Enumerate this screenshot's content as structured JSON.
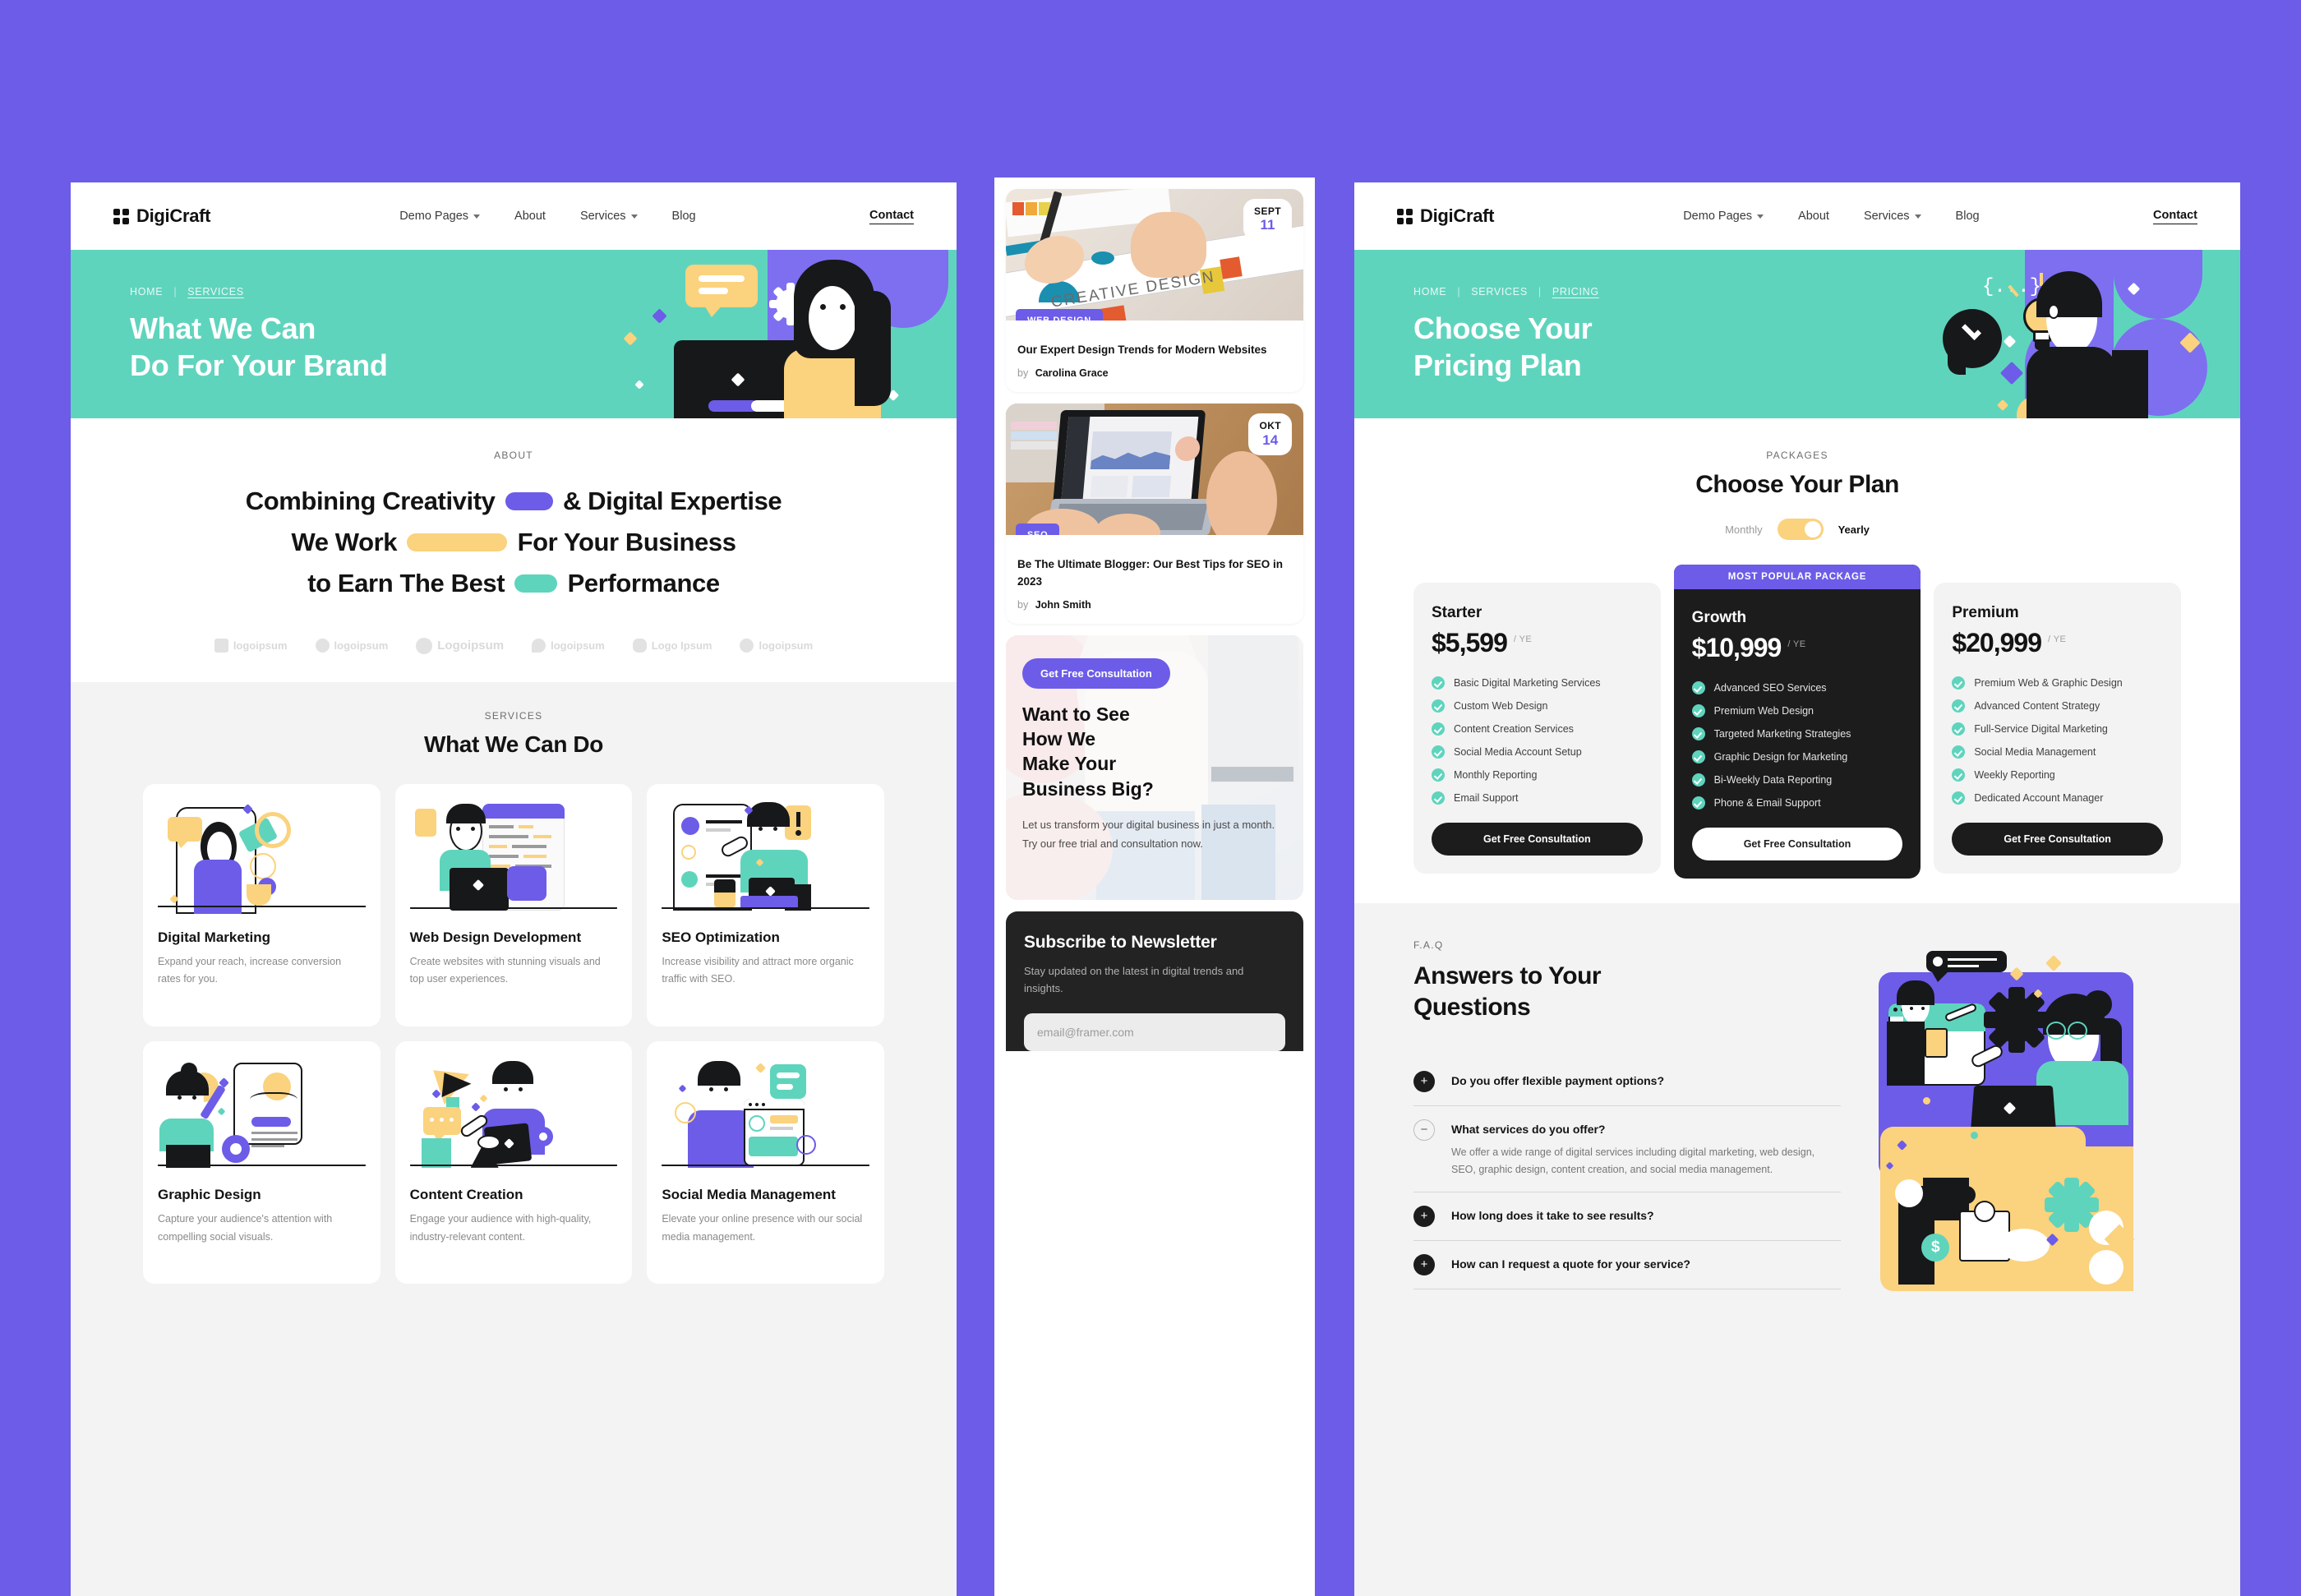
{
  "theme": {
    "bg_purple": "#6c5ce8",
    "teal": "#5fd4bd",
    "amber": "#fbd27d",
    "dark": "#1c1c1d"
  },
  "brand": {
    "name": "DigiCraft"
  },
  "nav": {
    "links": [
      {
        "label": "Demo Pages",
        "caret": true
      },
      {
        "label": "About",
        "caret": false
      },
      {
        "label": "Services",
        "caret": true
      },
      {
        "label": "Blog",
        "caret": false
      }
    ],
    "cta": "Contact"
  },
  "services_page": {
    "breadcrumbs": {
      "home": "HOME",
      "current": "SERVICES"
    },
    "hero_title_line1": "What We Can",
    "hero_title_line2": "Do For Your Brand",
    "about": {
      "eyebrow": "ABOUT",
      "line1_a": "Combining Creativity",
      "line1_b": "& Digital Expertise",
      "line2_a": "We Work",
      "line2_b": "For Your Business",
      "line3_a": "to Earn The Best",
      "line3_b": "Performance"
    },
    "logos": [
      "logoipsum",
      "logoipsum",
      "Logoipsum",
      "logoipsum",
      "Logo Ipsum",
      "logoipsum"
    ],
    "services": {
      "eyebrow": "SERVICES",
      "title": "What We Can Do",
      "cards": [
        {
          "title": "Digital Marketing",
          "desc": "Expand your reach, increase conversion rates for you."
        },
        {
          "title": "Web Design Development",
          "desc": "Create websites with stunning visuals and top user experiences."
        },
        {
          "title": "SEO Optimization",
          "desc": "Increase visibility and attract more organic traffic with SEO."
        },
        {
          "title": "Graphic Design",
          "desc": "Capture your audience's attention with compelling social visuals."
        },
        {
          "title": "Content Creation",
          "desc": "Engage your audience with high-quality, industry-relevant content."
        },
        {
          "title": "Social Media Management",
          "desc": "Elevate your online presence with our social media management."
        }
      ]
    }
  },
  "mobile_page": {
    "posts": [
      {
        "month": "SEPT",
        "day": "11",
        "tag": "WEB DESIGN",
        "title": "Our Expert Design Trends for Modern Websites",
        "by_label": "by",
        "author": "Carolina Grace"
      },
      {
        "month": "OKT",
        "day": "14",
        "tag": "SEO",
        "title": "Be The Ultimate Blogger: Our Best Tips for SEO in 2023",
        "by_label": "by",
        "author": "John Smith"
      }
    ],
    "cta": {
      "button": "Get Free Consultation",
      "title_line1": "Want to See",
      "title_line2": "How We",
      "title_line3": "Make Your",
      "title_line4": "Business Big?",
      "body": "Let us transform your digital business in just a month. Try our free trial and consultation now."
    },
    "newsletter": {
      "title": "Subscribe to Newsletter",
      "subtitle": "Stay updated on the latest in digital trends and insights.",
      "placeholder": "email@framer.com",
      "value": ""
    }
  },
  "pricing_page": {
    "breadcrumbs": {
      "home": "HOME",
      "services": "SERVICES",
      "current": "PRICING"
    },
    "hero_title_line1": "Choose Your",
    "hero_title_line2": "Pricing Plan",
    "packages": {
      "eyebrow": "PACKAGES",
      "title": "Choose Your Plan",
      "toggle": {
        "left": "Monthly",
        "right": "Yearly",
        "selected": "Yearly"
      }
    },
    "plans": [
      {
        "ribbon": "",
        "name": "Starter",
        "price": "$5,599",
        "period": "/ YE",
        "features": [
          "Basic Digital Marketing Services",
          "Custom Web Design",
          "Content Creation Services",
          "Social Media Account Setup",
          "Monthly Reporting",
          "Email Support"
        ],
        "button": "Get Free Consultation"
      },
      {
        "ribbon": "MOST POPULAR PACKAGE",
        "name": "Growth",
        "price": "$10,999",
        "period": "/ YE",
        "features": [
          "Advanced SEO Services",
          "Premium Web Design",
          "Targeted Marketing Strategies",
          "Graphic Design for Marketing",
          "Bi-Weekly Data Reporting",
          "Phone & Email Support"
        ],
        "button": "Get Free Consultation"
      },
      {
        "ribbon": "",
        "name": "Premium",
        "price": "$20,999",
        "period": "/ YE",
        "features": [
          "Premium Web & Graphic Design",
          "Advanced Content Strategy",
          "Full-Service Digital Marketing",
          "Social Media Management",
          "Weekly Reporting",
          "Dedicated Account Manager"
        ],
        "button": "Get Free Consultation"
      }
    ],
    "faq": {
      "eyebrow": "F.A.Q",
      "title_line1": "Answers to Your",
      "title_line2": "Questions",
      "items": [
        {
          "icon": "plus",
          "q": "Do you offer flexible payment options?",
          "a": ""
        },
        {
          "icon": "minus",
          "q": "What services do you offer?",
          "a": "We offer a wide range of digital services including digital marketing, web design, SEO, graphic design, content creation, and social media management."
        },
        {
          "icon": "plus",
          "q": "How long does it take to see results?",
          "a": ""
        },
        {
          "icon": "plus",
          "q": "How can I request a quote for your service?",
          "a": ""
        }
      ]
    }
  }
}
